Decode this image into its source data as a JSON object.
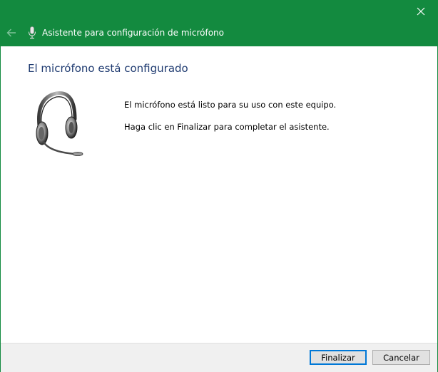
{
  "window": {
    "title": "Asistente para configuración de micrófono",
    "accent_color": "#138a3f",
    "close_icon": "close-icon",
    "back_icon": "back-arrow-icon",
    "title_icon": "microphone-icon"
  },
  "main": {
    "heading": "El micrófono está configurado",
    "message_ready": "El micrófono está listo para su uso con este equipo.",
    "message_finish": "Haga clic en Finalizar para completar el asistente.",
    "illustration": "headset-icon"
  },
  "footer": {
    "finish_label": "Finalizar",
    "cancel_label": "Cancelar"
  }
}
